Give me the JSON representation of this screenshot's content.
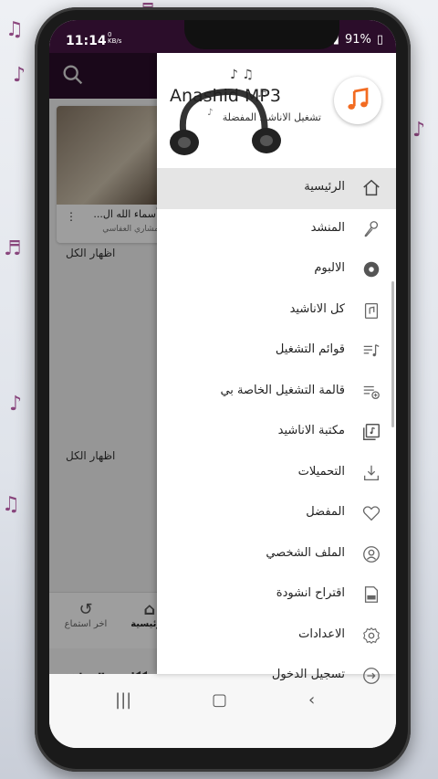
{
  "status_bar": {
    "time": "11:14",
    "speed_value": "0",
    "speed_unit": "KB/s",
    "battery": "91%"
  },
  "background_app": {
    "card": {
      "title": "أسماء الله ال...",
      "artist": "مشاري العفاسي",
      "more": "⋮"
    },
    "show_all_1": "اظهار الكل",
    "show_all_2": "اظهار الكل",
    "bottom_nav": {
      "home": "الرئيسية",
      "recent": "اخر استماع"
    }
  },
  "drawer": {
    "app_title": "Anashid MP3",
    "app_subtitle": "تشغيل الاناشيد المفضلة",
    "menu": [
      {
        "label": "الرئيسية",
        "icon": "home-icon",
        "active": true
      },
      {
        "label": "المنشد",
        "icon": "singer-icon"
      },
      {
        "label": "الالبوم",
        "icon": "album-icon"
      },
      {
        "label": "كل الاناشيد",
        "icon": "all-songs-icon"
      },
      {
        "label": "قوائم التشغيل",
        "icon": "playlists-icon"
      },
      {
        "label": "قالمة التشغيل الخاصة بي",
        "icon": "my-playlist-icon"
      },
      {
        "label": "مكتبة الاناشيد",
        "icon": "library-icon"
      },
      {
        "label": "التحميلات",
        "icon": "download-icon"
      },
      {
        "label": "المفضل",
        "icon": "heart-icon"
      },
      {
        "label": "الملف الشخصي",
        "icon": "profile-icon"
      },
      {
        "label": "اقتراح انشودة",
        "icon": "suggest-icon"
      },
      {
        "label": "الاعدادات",
        "icon": "settings-icon"
      },
      {
        "label": "تسجيل الدخول",
        "icon": "login-icon"
      }
    ]
  },
  "colors": {
    "accent": "#f26b21",
    "header_dark": "#2b0d2a"
  }
}
